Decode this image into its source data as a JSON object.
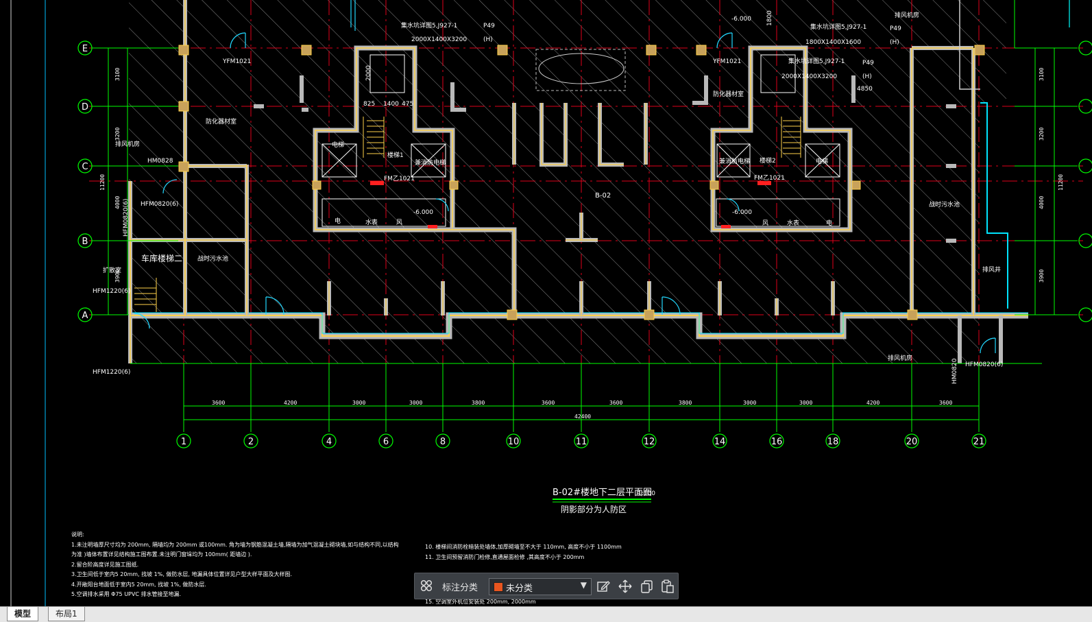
{
  "plan": {
    "title": "B-02#楼地下二层平面图",
    "scale": "1:100",
    "subtitle": "阴影部分为人防区",
    "zone_label": "B-02",
    "axes_letters": [
      "E",
      "D",
      "C",
      "B",
      "A"
    ],
    "axes_numbers": [
      "1",
      "2",
      "4",
      "6",
      "8",
      "10",
      "11",
      "12",
      "14",
      "16",
      "18",
      "20",
      "21"
    ],
    "bay_dims": [
      "3600",
      "4200",
      "3000",
      "3000",
      "3800",
      "3600",
      "3600",
      "3800",
      "3000",
      "3000",
      "4200",
      "3600"
    ],
    "total_dim": "42400",
    "left_dims": [
      "3100",
      "3200",
      "4000",
      "3900"
    ],
    "left_total": "11200",
    "right_dims": [
      "3100",
      "3200",
      "4000",
      "3900"
    ],
    "right_total": "11200"
  },
  "room_labels": {
    "sump_detail_l": "集水坑详图5,J927-1",
    "sump_size_l": "2000X1400X3200",
    "sump_ref_l": "P49",
    "sump_h_l": "(H)",
    "sump_detail_r": "集水坑详图5,J927-1",
    "sump_size_r": "1800X1400X1600",
    "sump_ref_r": "P49",
    "sump_h_r": "(H)",
    "sump_detail_r2": "集水坑详图5,J927-1",
    "sump_size_r2": "2000X1400X3200",
    "sump_ref_r2": "P49",
    "sump_h_r2": "(H)",
    "level_l": "-6.000",
    "level_r": "-6.000",
    "level_r2": "-6.000",
    "elev_1800": "1800",
    "door_yfm_l": "YFM1021",
    "door_yfm_r": "YFM1021",
    "fire_room_l": "防化器材室",
    "fire_room_r": "防化器材室",
    "exhaust_room_l": "排风机房",
    "exhaust_room_r": "排风机房",
    "exhaust_room_b": "排风机房",
    "hm0828": "HM0828",
    "hfm0820": "HFM0820(6)",
    "hfm0820_r": "HFM0820(6)",
    "hfm1220_a": "HFM1220(6)",
    "hfm1220_b": "HFM1220(6)",
    "hfm0820_v": "HFM0820(6)",
    "hm0820_r": "HM0820",
    "garage_stair": "车库楼梯二",
    "filter_room_l": "扩散室",
    "filter_room_r": "扩散室",
    "wash_l": "战时污水池",
    "wash_r": "战时污水池",
    "stair1": "楼梯1",
    "stair2": "楼梯2",
    "elev_l": "电梯",
    "elev_r": "电梯",
    "fire_elev_l": "兼消防电梯",
    "fire_elev_r": "兼消防电梯",
    "fmz_l": "FM乙1021",
    "fmz_r": "FM乙1021",
    "water_l": "水表",
    "water_r": "水表",
    "wind_l": "风",
    "wind_r": "风",
    "elec_l": "电",
    "elec_r": "电",
    "dim_825": "825",
    "dim_1400": "1400",
    "dim_475": "475",
    "dim_2000": "2000",
    "dim_4850": "4850",
    "exhaust_duct": "排风机房",
    "air_duct": "排风井"
  },
  "notes": {
    "title": "说明:",
    "lines": [
      "1.未注明墙厚尺寸均为    200mm,    隔墙均为  200mm    或100mm.        角为墙为钢筋混凝土墙,隔墙为加气混凝土砌块墙,如与结构不同,以结构",
      "为准 )墙体布置详见结构施工图布置.未注明门窗垛均为                100mm(       距墙边 ).",
      "2.留合阶高度详见施工图纸.",
      "3.卫生间低于室内5       20mm,     找坡 1%,  做防水层,   地漏具体位置详见户型大样平面及大样图.",
      "4.开敞阳台地面低于室内5      20mm,     找坡 1%,  做防水层.",
      "5.空调排水采用    Φ75 UPVC     排水管接至地漏."
    ],
    "lines_right": [
      "10.    楼梯间消防栓暗装处墙体,加厚砌墙至不大于            110mm,     高度不小于   1100mm",
      "11.    卫生间预留消防门检修,直通屋面检修              ,其高度不小于      200mm",
      "15.    空调室外机位安装处                200mm,                    2000mm"
    ]
  },
  "toolbar": {
    "category_label": "标注分类",
    "category_value": "未分类",
    "swatch_color": "#e8551f",
    "icons": [
      "grid-icon",
      "edit-icon",
      "move-icon",
      "copy-icon",
      "paste-icon"
    ]
  },
  "tabs": [
    "模型",
    "布局1"
  ],
  "colors": {
    "background": "#000000",
    "axis": "#00ff00",
    "grid_red": "#ff0000",
    "wall_yellow": "#ffd24a",
    "wall_gray": "#b9b9b9",
    "hatch": "#8a8a8a",
    "cyan": "#00ffff",
    "text": "#ffffff"
  }
}
